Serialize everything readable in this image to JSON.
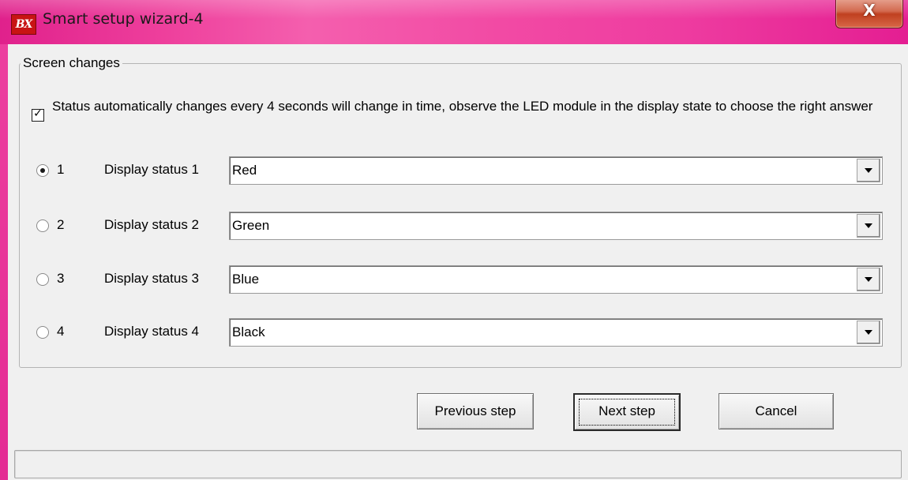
{
  "window": {
    "app_icon_text": "BX",
    "title": "Smart setup wizard-4",
    "close_glyph": "X"
  },
  "group": {
    "label": "Screen changes"
  },
  "auto_change": {
    "checked": true,
    "check_glyph": "✓",
    "label": "Status automatically changes every 4 seconds will change in time, observe the LED module in the display state to choose the right answer"
  },
  "statuses": [
    {
      "number": "1",
      "label": "Display status 1",
      "value": "Red",
      "selected": true
    },
    {
      "number": "2",
      "label": "Display status 2",
      "value": "Green",
      "selected": false
    },
    {
      "number": "3",
      "label": "Display status 3",
      "value": "Blue",
      "selected": false
    },
    {
      "number": "4",
      "label": "Display status 4",
      "value": "Black",
      "selected": false
    }
  ],
  "buttons": {
    "previous": "Previous step",
    "next": "Next step",
    "cancel": "Cancel"
  },
  "status_bar": {
    "text": ""
  }
}
